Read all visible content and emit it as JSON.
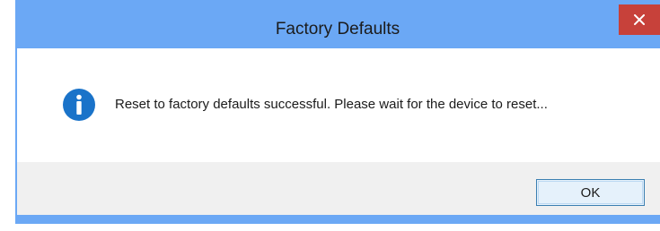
{
  "window": {
    "title": "Factory Defaults",
    "close_icon": "close-icon",
    "titlebar_color": "#6ba8f5",
    "close_button_color": "#c7413a"
  },
  "content": {
    "icon": "info-icon",
    "icon_color": "#1a73c9",
    "message": "Reset to factory defaults successful. Please wait for the device to reset..."
  },
  "buttons": {
    "ok_label": "OK"
  }
}
